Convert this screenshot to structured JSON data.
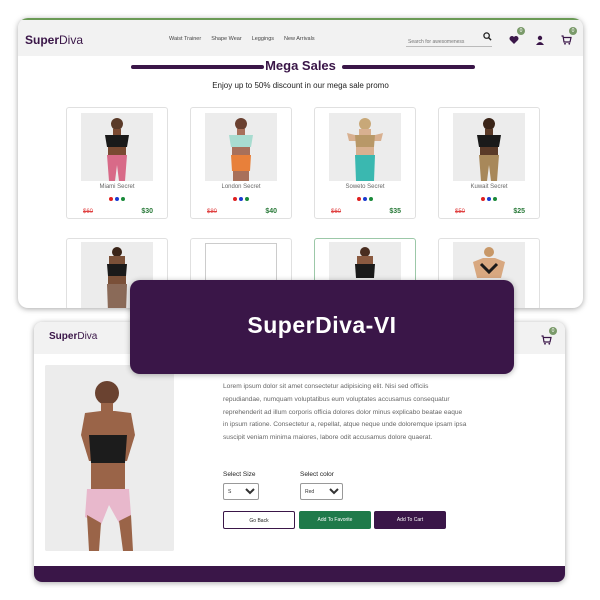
{
  "top_window": {
    "logo_brand": "Super",
    "logo_accent": "Diva",
    "nav": [
      "Waist Trainer",
      "Shape Wear",
      "Leggings",
      "New Arrivals"
    ],
    "search_placeholder": "Search for awesomeness",
    "wishlist_count": "0",
    "cart_count": "0",
    "sales_title": "Mega Sales",
    "sales_subtitle": "Enjoy up to 50% discount in our mega sale promo",
    "products": [
      {
        "name": "Miami Secret",
        "old_price": "$60",
        "new_price": "$30"
      },
      {
        "name": "London Secret",
        "old_price": "$80",
        "new_price": "$40"
      },
      {
        "name": "Soweto Secret",
        "old_price": "$60",
        "new_price": "$35"
      },
      {
        "name": "Kuwait Secret",
        "old_price": "$50",
        "new_price": "$25"
      }
    ],
    "swatch_colors": [
      "#e02020",
      "#1a3ad0",
      "#1a8a3a"
    ]
  },
  "banner": {
    "title": "SuperDiva-VI"
  },
  "bottom_window": {
    "logo_brand": "Super",
    "logo_accent": "Diva",
    "cart_count": "0",
    "description": "Lorem ipsum dolor sit amet consectetur adipisicing elit. Nisi sed officiis repudiandae, numquam voluptatibus eum voluptates accusamus consequatur reprehenderit ad illum corporis officia dolores dolor minus explicabo beatae eaque in ipsum ratione. Consectetur a, repellat, atque neque unde doloremque ipsam ipsa suscipit veniam minima maiores, labore odit accusamus dolore quaerat.",
    "size_label": "Select Size",
    "size_value": "S",
    "color_label": "Select color",
    "color_value": "Red",
    "go_back": "Go Back",
    "add_favorite": "Add To Favorite",
    "add_cart": "Add To Cart"
  },
  "colors": {
    "brand": "#3a1648",
    "green": "#1f7a4a",
    "old_price": "#e04040",
    "new_price": "#2a7a3a"
  }
}
